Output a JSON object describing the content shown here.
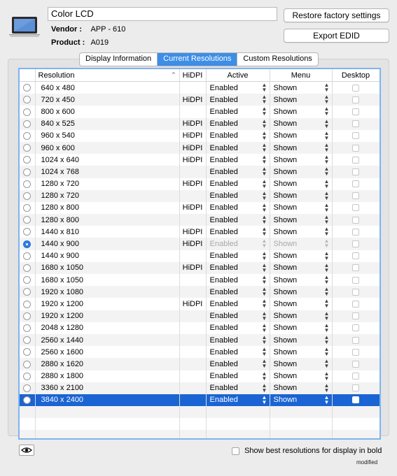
{
  "header": {
    "display_name": "Color LCD",
    "vendor_label": "Vendor :",
    "vendor_value": "APP - 610",
    "product_label": "Product :",
    "product_value": "A019",
    "restore_button": "Restore factory settings",
    "export_button": "Export EDID"
  },
  "tabs": [
    {
      "label": "Display Information",
      "active": false
    },
    {
      "label": "Current Resolutions",
      "active": true
    },
    {
      "label": "Custom Resolutions",
      "active": false
    }
  ],
  "table": {
    "columns": [
      "Resolution",
      "HiDPI",
      "Active",
      "Menu",
      "Desktop"
    ],
    "rows": [
      {
        "res": "640 x 480",
        "hidpi": "",
        "active": "Enabled",
        "menu": "Shown"
      },
      {
        "res": "720 x 450",
        "hidpi": "HiDPI",
        "active": "Enabled",
        "menu": "Shown"
      },
      {
        "res": "800 x 600",
        "hidpi": "",
        "active": "Enabled",
        "menu": "Shown"
      },
      {
        "res": "840 x 525",
        "hidpi": "HiDPI",
        "active": "Enabled",
        "menu": "Shown"
      },
      {
        "res": "960 x 540",
        "hidpi": "HiDPI",
        "active": "Enabled",
        "menu": "Shown"
      },
      {
        "res": "960 x 600",
        "hidpi": "HiDPI",
        "active": "Enabled",
        "menu": "Shown"
      },
      {
        "res": "1024 x 640",
        "hidpi": "HiDPI",
        "active": "Enabled",
        "menu": "Shown"
      },
      {
        "res": "1024 x 768",
        "hidpi": "",
        "active": "Enabled",
        "menu": "Shown"
      },
      {
        "res": "1280 x 720",
        "hidpi": "HiDPI",
        "active": "Enabled",
        "menu": "Shown"
      },
      {
        "res": "1280 x 720",
        "hidpi": "",
        "active": "Enabled",
        "menu": "Shown"
      },
      {
        "res": "1280 x 800",
        "hidpi": "HiDPI",
        "active": "Enabled",
        "menu": "Shown"
      },
      {
        "res": "1280 x 800",
        "hidpi": "",
        "active": "Enabled",
        "menu": "Shown"
      },
      {
        "res": "1440 x 810",
        "hidpi": "HiDPI",
        "active": "Enabled",
        "menu": "Shown"
      },
      {
        "res": "1440 x 900",
        "hidpi": "HiDPI",
        "active": "Enabled",
        "menu": "Shown",
        "current": true,
        "disabled": true
      },
      {
        "res": "1440 x 900",
        "hidpi": "",
        "active": "Enabled",
        "menu": "Shown"
      },
      {
        "res": "1680 x 1050",
        "hidpi": "HiDPI",
        "active": "Enabled",
        "menu": "Shown"
      },
      {
        "res": "1680 x 1050",
        "hidpi": "",
        "active": "Enabled",
        "menu": "Shown"
      },
      {
        "res": "1920 x 1080",
        "hidpi": "",
        "active": "Enabled",
        "menu": "Shown"
      },
      {
        "res": "1920 x 1200",
        "hidpi": "HiDPI",
        "active": "Enabled",
        "menu": "Shown"
      },
      {
        "res": "1920 x 1200",
        "hidpi": "",
        "active": "Enabled",
        "menu": "Shown"
      },
      {
        "res": "2048 x 1280",
        "hidpi": "",
        "active": "Enabled",
        "menu": "Shown"
      },
      {
        "res": "2560 x 1440",
        "hidpi": "",
        "active": "Enabled",
        "menu": "Shown"
      },
      {
        "res": "2560 x 1600",
        "hidpi": "",
        "active": "Enabled",
        "menu": "Shown"
      },
      {
        "res": "2880 x 1620",
        "hidpi": "",
        "active": "Enabled",
        "menu": "Shown"
      },
      {
        "res": "2880 x 1800",
        "hidpi": "",
        "active": "Enabled",
        "menu": "Shown"
      },
      {
        "res": "3360 x 2100",
        "hidpi": "",
        "active": "Enabled",
        "menu": "Shown"
      },
      {
        "res": "3840 x 2400",
        "hidpi": "",
        "active": "Enabled",
        "menu": "Shown",
        "selected": true
      }
    ]
  },
  "footer": {
    "bold_checkbox_label": "Show best resolutions for display in bold",
    "status": "modified"
  },
  "colors": {
    "accent": "#3d8ee6",
    "selection": "#1a64d3",
    "window_bg": "#ececec"
  },
  "icons": {
    "display": "laptop-icon",
    "preview": "eye-icon",
    "sort": "sort-ascending-icon",
    "popup": "popup-stepper-icon"
  }
}
